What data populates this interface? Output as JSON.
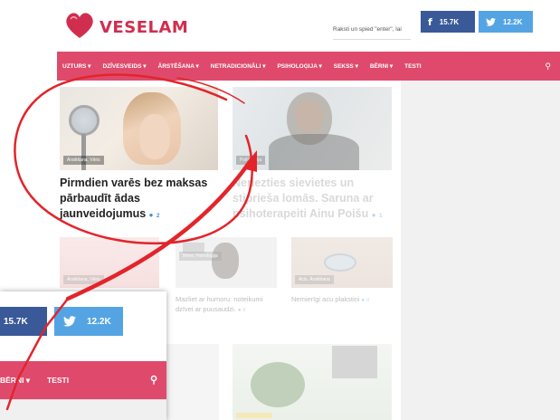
{
  "brand": {
    "name": "VESELAM"
  },
  "search": {
    "placeholder": "Raksti un spied \"enter\", lai"
  },
  "social": {
    "facebook_count": "15.7K",
    "twitter_count": "12.2K"
  },
  "nav": {
    "items": [
      "UZTURS ▾",
      "DZĪVESVEIDS ▾",
      "ĀRSTĒŠANA ▾",
      "NETRADICIONĀLI ▾",
      "PSIHOLOĢIJA ▾",
      "SEKSS ▾",
      "BĒRNI ▾",
      "TESTI"
    ]
  },
  "featured": [
    {
      "category": "Ārstēšana, Vēris",
      "title": "Pirmdien varēs bez maksas pārbaudīt ādas jaunveidojumus",
      "comments": "2"
    },
    {
      "category": "Psiholoģija",
      "title": "Neriezties sievietes un stiprieša lomās. Saruna ar psihoterapeiti Ainu Poišu",
      "comments": "1"
    }
  ],
  "small_cards": [
    {
      "category": "Ārstēšana, Vēris",
      "title": "",
      "comments": ""
    },
    {
      "category": "Bērni, Psiholoģija",
      "title": "Mazliet ar humoru: noteikumi dzīvei ar puusaudzi.",
      "comments": "0"
    },
    {
      "category": "Acis, Ārstēšana",
      "title": "Nemierīgi acu plakstiņi",
      "comments": "0"
    }
  ],
  "inset": {
    "facebook_count": "15.7K",
    "twitter_count": "12.2K",
    "nav_items": [
      "BĒRNI ▾",
      "TESTI"
    ]
  },
  "colors": {
    "brand": "#d12d4f",
    "nav": "#df4a6c",
    "facebook": "#3a5998",
    "twitter": "#54a4e4",
    "annotation": "#e2252b"
  }
}
